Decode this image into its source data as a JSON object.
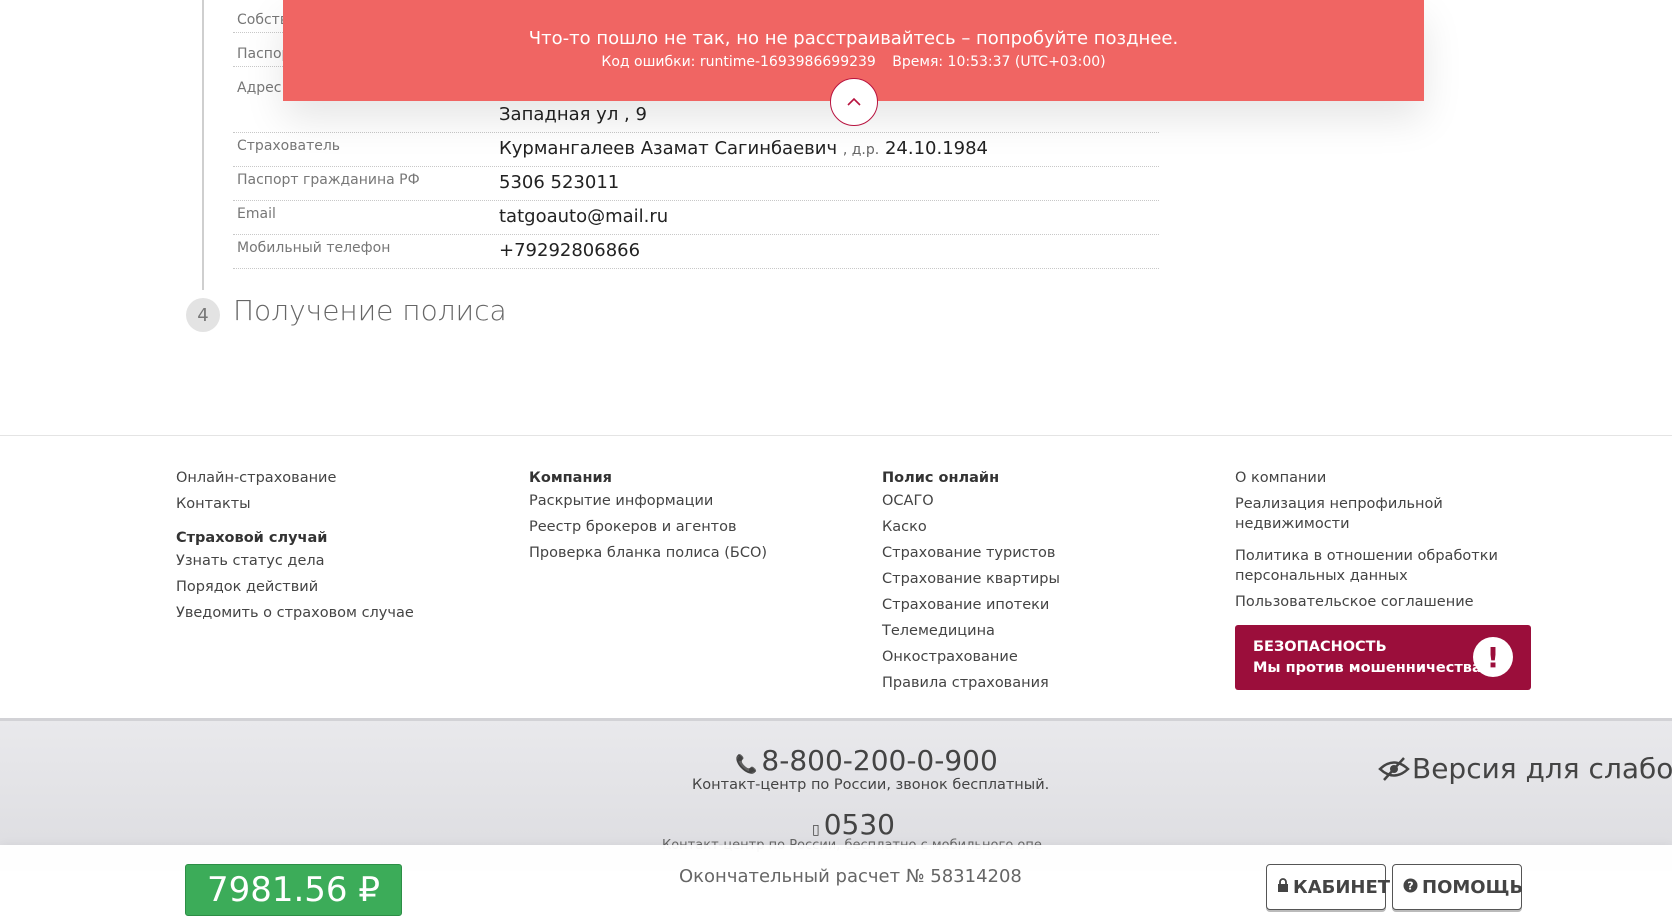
{
  "error": {
    "message": "Что-то пошло не так, но не расстраивайтесь – попробуйте позднее.",
    "code_label": "Код ошибки: runtime-1693986699239",
    "time_label": "Время: 10:53:37 (UTC+03:00)"
  },
  "rows": [
    {
      "label": "Собстве",
      "value": ""
    },
    {
      "label": "Паспор",
      "value": ""
    },
    {
      "label": "Адрес",
      "value": "Западная ул , 9"
    },
    {
      "label": "Страхователь",
      "value": "Курмангалеев Азамат Сагинбаевич",
      "dob_prefix": ", д.р.",
      "dob": "24.10.1984"
    },
    {
      "label": "Паспорт гражданина РФ",
      "value": "5306 523011"
    },
    {
      "label": "Email",
      "value": "tatgoauto@mail.ru"
    },
    {
      "label": "Мобильный телефон",
      "value": "+79292806866"
    }
  ],
  "step": {
    "number": "4",
    "title": "Получение полиса"
  },
  "footer": {
    "col1": {
      "links": [
        "Онлайн-страхование",
        "Контакты"
      ],
      "heading": "Страховой случай",
      "links2": [
        "Узнать статус дела",
        "Порядок действий",
        "Уведомить о страховом случае"
      ]
    },
    "col2": {
      "heading": "Компания",
      "links": [
        "Раскрытие информации",
        "Реестр брокеров и агентов",
        "Проверка бланка полиса (БСО)"
      ]
    },
    "col3": {
      "heading": "Полис онлайн",
      "links": [
        "ОСАГО",
        "Каско",
        "Страхование туристов",
        "Страхование квартиры",
        "Страхование ипотеки",
        "Телемедицина",
        "Онкострахование",
        "Правила страхования"
      ]
    },
    "col4": {
      "links": [
        "О компании",
        "Реализация непрофильной недвижимости",
        "Политика в отношении обработки персональных данных",
        "Пользовательское соглашение"
      ]
    },
    "security": {
      "line1": "БЕЗОПАСНОСТЬ",
      "line2": "Мы против мошенничества",
      "icon": "!"
    }
  },
  "contacts": {
    "phone": "8-800-200-0-900",
    "phone_note": "Контакт-центр по России, звонок бесплатный.",
    "short": "0530",
    "short_note": "Контакт-центр по России, бесплатно с мобильного опе",
    "low_vision": "Версия для слабов"
  },
  "bottom_bar": {
    "price": "7981.56 ₽",
    "calc_label": "Окончательный расчет № 58314208",
    "cabinet": "КАБИНЕТ",
    "help": "ПОМОЩЬ"
  },
  "colors": {
    "error": "#f06563",
    "brand": "#9b0e3b",
    "price": "#3cac59"
  }
}
